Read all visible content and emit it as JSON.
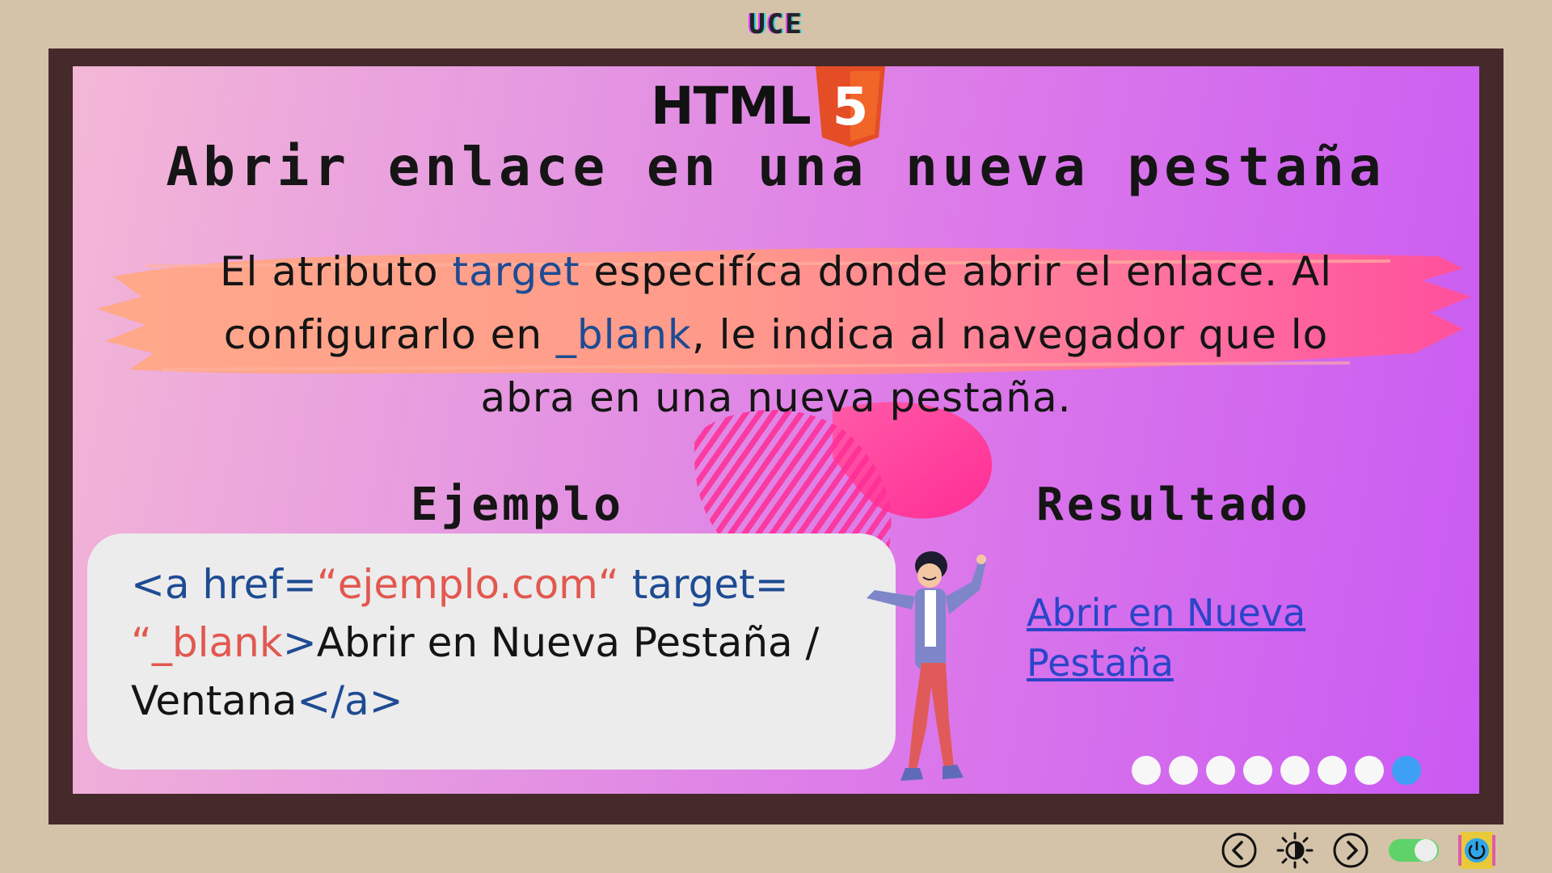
{
  "header": {
    "label": "UCE"
  },
  "slide": {
    "logo_text": "HTML",
    "logo_badge": "5",
    "title": "Abrir enlace en una nueva pestaña",
    "description": {
      "part1": "El atributo ",
      "kw1": "target",
      "part2": " especifíca  donde abrir el enlace. Al",
      "part3": "configurarlo en ",
      "kw2": "_blank",
      "part4": ", le indica al navegador que lo",
      "part5": "abra en una nueva pestaña."
    },
    "example_heading": "Ejemplo",
    "result_heading": "Resultado",
    "code": {
      "t1": "<a href=",
      "t2": "“ejemplo.com“",
      "t3": " target=",
      "t4": "“_blank",
      "t5": ">",
      "t6": "Abrir en Nueva Pestaña / Ventana",
      "t7": "</a>"
    },
    "result_link": "Abrir en Nueva Pestaña",
    "pagination": {
      "total": 8,
      "active": 8
    }
  },
  "controls": [
    "prev-icon",
    "brightness-icon",
    "next-icon",
    "toggle-switch",
    "power-icon"
  ],
  "colors": {
    "frame": "#45292b",
    "accent_blue": "#1e4b93",
    "accent_red": "#e2584f",
    "active_dot": "#3ea0f5"
  }
}
